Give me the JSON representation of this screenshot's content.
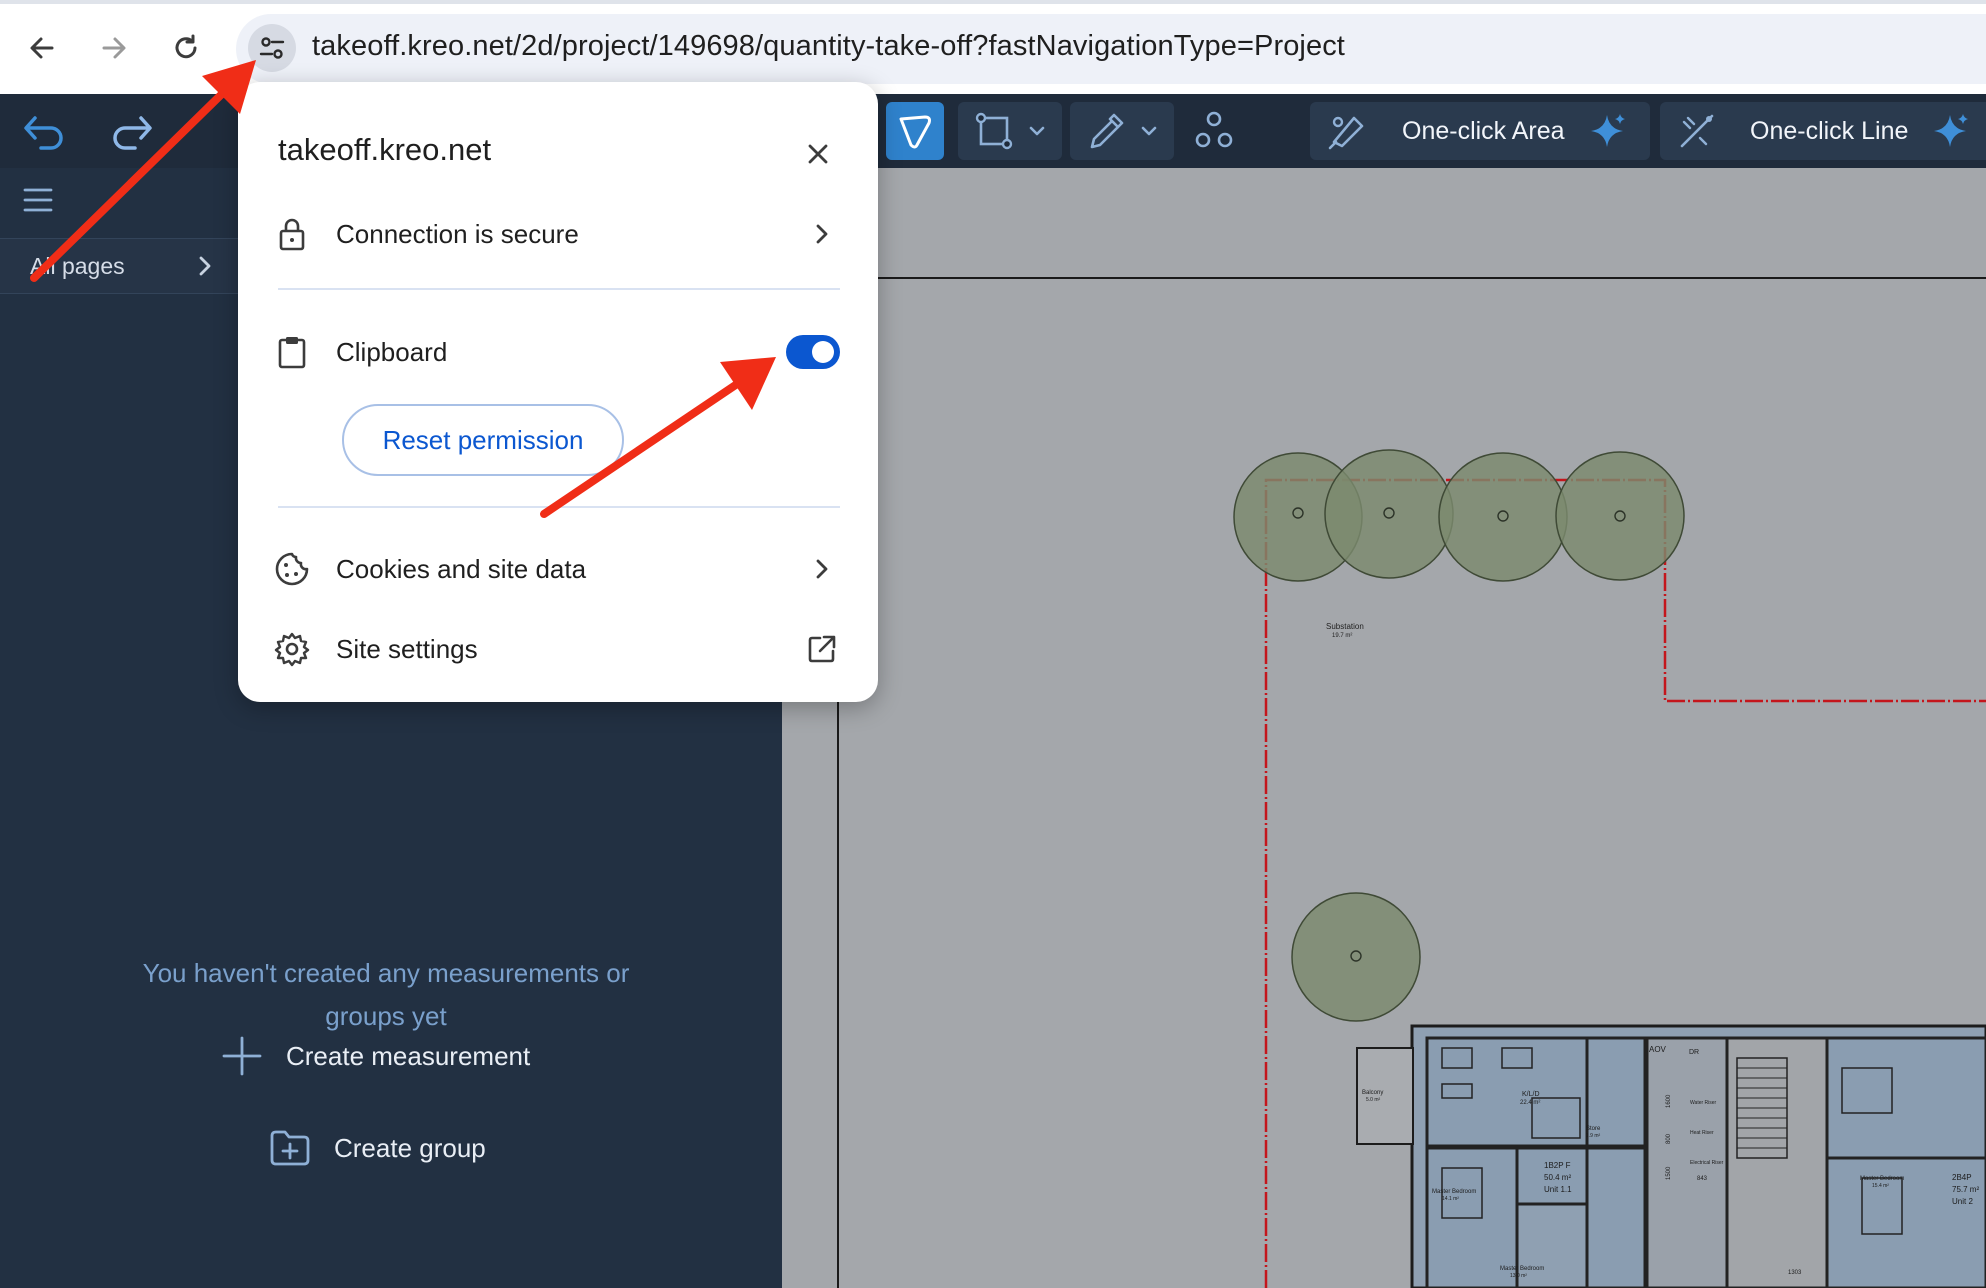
{
  "browser": {
    "url": "takeoff.kreo.net/2d/project/149698/quantity-take-off?fastNavigationType=Project"
  },
  "popup": {
    "title": "takeoff.kreo.net",
    "connection_label": "Connection is secure",
    "clipboard_label": "Clipboard",
    "clipboard_enabled": true,
    "reset_label": "Reset permission",
    "cookies_label": "Cookies and site data",
    "site_settings_label": "Site settings"
  },
  "sidebar": {
    "pages_label": "All pages",
    "empty_message": "You haven't created any measurements or groups yet",
    "create_measurement_label": "Create measurement",
    "create_group_label": "Create group"
  },
  "toolbar": {
    "one_click_area_label": "One-click Area",
    "one_click_line_label": "One-click Line"
  },
  "drawing": {
    "substation_label": "Substation",
    "substation_area": "19.7 m²",
    "balcony_label": "Balcony",
    "balcony_area": "5.0 m²",
    "kld_label": "K/L/D",
    "kld_area": "22.4 m²",
    "store_label": "Store",
    "store_area": "1.9 m²",
    "unit_label": "1B2P F",
    "unit_area": "50.4 m²",
    "unit_id": "Unit 1.1",
    "master_bedroom_label": "Master Bedroom",
    "master_bedroom_area": "14.1 m²",
    "master_bedroom_2_area": "13.0 m²",
    "master_bedroom_3_area": "15.4 m²",
    "aov_label": "AOV",
    "dr_label": "DR",
    "water_riser_label": "Water Riser",
    "heat_riser_label": "Heat Riser",
    "electrical_riser_label": "Electrical Riser",
    "dim_1600": "1600",
    "dim_800": "800",
    "dim_1500": "1500",
    "dim_843": "843",
    "dim_1303": "1303",
    "unit_2_label": "2B4P",
    "unit_2_area": "75.7 m²",
    "unit_2_id": "Unit 2"
  },
  "colors": {
    "accent_blue": "#0b57d0",
    "sidebar_bg": "#223042",
    "tree_fill": "#7b8a6e",
    "boundary_red": "#c4161c",
    "arrow_red": "#f02d17"
  }
}
